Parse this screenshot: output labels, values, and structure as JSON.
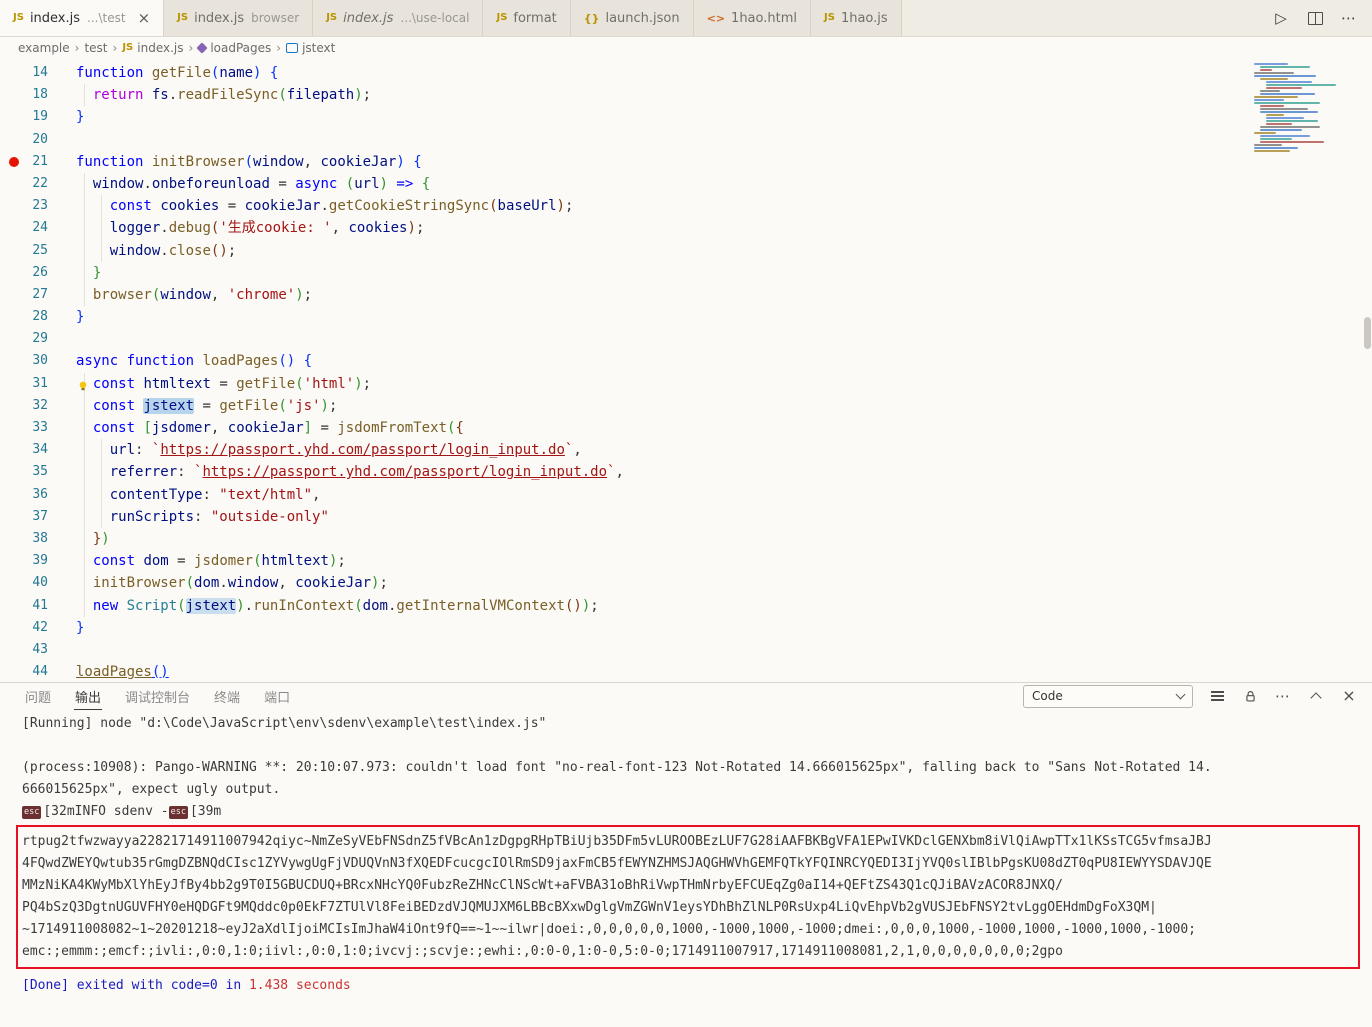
{
  "icons": {
    "run-icon": "▷",
    "more-icon": "⋯",
    "close-icon": "×",
    "js-file-icon": "JS",
    "json-file-icon": "{}",
    "html-file-icon": "<>"
  },
  "tab_bar": {
    "tabs": [
      {
        "label": "index.js",
        "hint": "...\\test",
        "icon": "js",
        "active": true,
        "closable": true
      },
      {
        "label": "index.js",
        "hint": "browser",
        "icon": "js"
      },
      {
        "label": "index.js",
        "hint": "...\\use-local",
        "icon": "js",
        "italic": true
      },
      {
        "label": "format",
        "hint": "",
        "icon": "js"
      },
      {
        "label": "launch.json",
        "hint": "",
        "icon": "braces"
      },
      {
        "label": "1hao.html",
        "hint": "",
        "icon": "html"
      },
      {
        "label": "1hao.js",
        "hint": "",
        "icon": "js"
      }
    ]
  },
  "breadcrumb": {
    "items": [
      {
        "label": "example"
      },
      {
        "label": "test"
      },
      {
        "label": "index.js",
        "icon": "js"
      },
      {
        "label": "loadPages",
        "icon": "method"
      },
      {
        "label": "jstext",
        "icon": "variable"
      }
    ]
  },
  "editor": {
    "lines": [
      {
        "n": 14,
        "ind": 0,
        "tokens": [
          [
            "function",
            "kw"
          ],
          [
            " ",
            "pl"
          ],
          [
            "getFile",
            "fn"
          ],
          [
            "(",
            "b1"
          ],
          [
            "name",
            "vr"
          ],
          [
            ")",
            "b1"
          ],
          [
            " ",
            "pl"
          ],
          [
            "{",
            "b1"
          ]
        ]
      },
      {
        "n": 18,
        "ind": 1,
        "tokens": [
          [
            "  ",
            "pl"
          ],
          [
            "return",
            "ctl"
          ],
          [
            " ",
            "pl"
          ],
          [
            "fs",
            "vr"
          ],
          [
            ".",
            "pl"
          ],
          [
            "readFileSync",
            "fn"
          ],
          [
            "(",
            "b2"
          ],
          [
            "filepath",
            "vr"
          ],
          [
            ")",
            "b2"
          ],
          [
            ";",
            "pl"
          ]
        ]
      },
      {
        "n": 19,
        "ind": 0,
        "tokens": [
          [
            "}",
            "b1"
          ]
        ]
      },
      {
        "n": 20,
        "ind": 0,
        "tokens": []
      },
      {
        "n": 21,
        "ind": 0,
        "bp": true,
        "tokens": [
          [
            "function",
            "kw"
          ],
          [
            " ",
            "pl"
          ],
          [
            "initBrowser",
            "fn"
          ],
          [
            "(",
            "b1"
          ],
          [
            "window",
            "vr"
          ],
          [
            ", ",
            "pl"
          ],
          [
            "cookieJar",
            "vr"
          ],
          [
            ")",
            "b1"
          ],
          [
            " ",
            "pl"
          ],
          [
            "{",
            "b1"
          ]
        ]
      },
      {
        "n": 22,
        "ind": 1,
        "tokens": [
          [
            "  ",
            "pl"
          ],
          [
            "window",
            "vr"
          ],
          [
            ".",
            "pl"
          ],
          [
            "onbeforeunload",
            "vr"
          ],
          [
            " = ",
            "pl"
          ],
          [
            "async",
            "kw"
          ],
          [
            " ",
            "pl"
          ],
          [
            "(",
            "b2"
          ],
          [
            "url",
            "vr"
          ],
          [
            ")",
            "b2"
          ],
          [
            " ",
            "pl"
          ],
          [
            "=>",
            "kw"
          ],
          [
            " ",
            "pl"
          ],
          [
            "{",
            "b2"
          ]
        ]
      },
      {
        "n": 23,
        "ind": 2,
        "tokens": [
          [
            "    ",
            "pl"
          ],
          [
            "const",
            "kw"
          ],
          [
            " ",
            "pl"
          ],
          [
            "cookies",
            "vr"
          ],
          [
            " = ",
            "pl"
          ],
          [
            "cookieJar",
            "vr"
          ],
          [
            ".",
            "pl"
          ],
          [
            "getCookieStringSync",
            "fn"
          ],
          [
            "(",
            "b3"
          ],
          [
            "baseUrl",
            "vr"
          ],
          [
            ")",
            "b3"
          ],
          [
            ";",
            "pl"
          ]
        ]
      },
      {
        "n": 24,
        "ind": 2,
        "tokens": [
          [
            "    ",
            "pl"
          ],
          [
            "logger",
            "vr"
          ],
          [
            ".",
            "pl"
          ],
          [
            "debug",
            "fn"
          ],
          [
            "(",
            "b3"
          ],
          [
            "'生成cookie: '",
            "str"
          ],
          [
            ", ",
            "pl"
          ],
          [
            "cookies",
            "vr"
          ],
          [
            ")",
            "b3"
          ],
          [
            ";",
            "pl"
          ]
        ]
      },
      {
        "n": 25,
        "ind": 2,
        "tokens": [
          [
            "    ",
            "pl"
          ],
          [
            "window",
            "vr"
          ],
          [
            ".",
            "pl"
          ],
          [
            "close",
            "fn"
          ],
          [
            "(",
            "b3"
          ],
          [
            ")",
            "b3"
          ],
          [
            ";",
            "pl"
          ]
        ]
      },
      {
        "n": 26,
        "ind": 1,
        "tokens": [
          [
            "  ",
            "pl"
          ],
          [
            "}",
            "b2"
          ]
        ]
      },
      {
        "n": 27,
        "ind": 1,
        "tokens": [
          [
            "  ",
            "pl"
          ],
          [
            "browser",
            "fn"
          ],
          [
            "(",
            "b2"
          ],
          [
            "window",
            "vr"
          ],
          [
            ", ",
            "pl"
          ],
          [
            "'chrome'",
            "str"
          ],
          [
            ")",
            "b2"
          ],
          [
            ";",
            "pl"
          ]
        ]
      },
      {
        "n": 28,
        "ind": 0,
        "tokens": [
          [
            "}",
            "b1"
          ]
        ]
      },
      {
        "n": 29,
        "ind": 0,
        "tokens": []
      },
      {
        "n": 30,
        "ind": 0,
        "tokens": [
          [
            "async",
            "kw"
          ],
          [
            " ",
            "pl"
          ],
          [
            "function",
            "kw"
          ],
          [
            " ",
            "pl"
          ],
          [
            "loadPages",
            "fn"
          ],
          [
            "(",
            "b1"
          ],
          [
            ")",
            "b1"
          ],
          [
            " ",
            "pl"
          ],
          [
            "{",
            "b1"
          ]
        ]
      },
      {
        "n": 31,
        "ind": 1,
        "bulb": true,
        "tokens": [
          [
            "  ",
            "pl"
          ],
          [
            "const",
            "kw"
          ],
          [
            " ",
            "pl"
          ],
          [
            "htmltext",
            "vr"
          ],
          [
            " = ",
            "pl"
          ],
          [
            "getFile",
            "fn"
          ],
          [
            "(",
            "b2"
          ],
          [
            "'html'",
            "str"
          ],
          [
            ")",
            "b2"
          ],
          [
            ";",
            "pl"
          ]
        ]
      },
      {
        "n": 32,
        "ind": 1,
        "tokens": [
          [
            "  ",
            "pl"
          ],
          [
            "const",
            "kw"
          ],
          [
            " ",
            "pl"
          ],
          [
            "jstext",
            "vr hl1"
          ],
          [
            " = ",
            "pl"
          ],
          [
            "getFile",
            "fn"
          ],
          [
            "(",
            "b2"
          ],
          [
            "'js'",
            "str"
          ],
          [
            ")",
            "b2"
          ],
          [
            ";",
            "pl"
          ]
        ]
      },
      {
        "n": 33,
        "ind": 1,
        "tokens": [
          [
            "  ",
            "pl"
          ],
          [
            "const",
            "kw"
          ],
          [
            " ",
            "pl"
          ],
          [
            "[",
            "b2"
          ],
          [
            "jsdomer",
            "vr"
          ],
          [
            ", ",
            "pl"
          ],
          [
            "cookieJar",
            "vr"
          ],
          [
            "]",
            "b2"
          ],
          [
            " = ",
            "pl"
          ],
          [
            "jsdomFromText",
            "fn"
          ],
          [
            "(",
            "b2"
          ],
          [
            "{",
            "b3"
          ]
        ]
      },
      {
        "n": 34,
        "ind": 2,
        "tokens": [
          [
            "    ",
            "pl"
          ],
          [
            "url",
            "vr"
          ],
          [
            ": ",
            "pl"
          ],
          [
            "`",
            "str"
          ],
          [
            "https://passport.yhd.com/passport/login_input.do",
            "lnk"
          ],
          [
            "`",
            "str"
          ],
          [
            ",",
            "pl"
          ]
        ]
      },
      {
        "n": 35,
        "ind": 2,
        "tokens": [
          [
            "    ",
            "pl"
          ],
          [
            "referrer",
            "vr"
          ],
          [
            ": ",
            "pl"
          ],
          [
            "`",
            "str"
          ],
          [
            "https://passport.yhd.com/passport/login_input.do",
            "lnk"
          ],
          [
            "`",
            "str"
          ],
          [
            ",",
            "pl"
          ]
        ]
      },
      {
        "n": 36,
        "ind": 2,
        "tokens": [
          [
            "    ",
            "pl"
          ],
          [
            "contentType",
            "vr"
          ],
          [
            ": ",
            "pl"
          ],
          [
            "\"text/html\"",
            "str"
          ],
          [
            ",",
            "pl"
          ]
        ]
      },
      {
        "n": 37,
        "ind": 2,
        "tokens": [
          [
            "    ",
            "pl"
          ],
          [
            "runScripts",
            "vr"
          ],
          [
            ": ",
            "pl"
          ],
          [
            "\"outside-only\"",
            "str"
          ]
        ]
      },
      {
        "n": 38,
        "ind": 1,
        "tokens": [
          [
            "  ",
            "pl"
          ],
          [
            "}",
            "b3"
          ],
          [
            ")",
            "b2"
          ]
        ]
      },
      {
        "n": 39,
        "ind": 1,
        "tokens": [
          [
            "  ",
            "pl"
          ],
          [
            "const",
            "kw"
          ],
          [
            " ",
            "pl"
          ],
          [
            "dom",
            "vr"
          ],
          [
            " = ",
            "pl"
          ],
          [
            "jsdomer",
            "fn"
          ],
          [
            "(",
            "b2"
          ],
          [
            "htmltext",
            "vr"
          ],
          [
            ")",
            "b2"
          ],
          [
            ";",
            "pl"
          ]
        ]
      },
      {
        "n": 40,
        "ind": 1,
        "tokens": [
          [
            "  ",
            "pl"
          ],
          [
            "initBrowser",
            "fn"
          ],
          [
            "(",
            "b2"
          ],
          [
            "dom",
            "vr"
          ],
          [
            ".",
            "pl"
          ],
          [
            "window",
            "vr"
          ],
          [
            ", ",
            "pl"
          ],
          [
            "cookieJar",
            "vr"
          ],
          [
            ")",
            "b2"
          ],
          [
            ";",
            "pl"
          ]
        ]
      },
      {
        "n": 41,
        "ind": 1,
        "tokens": [
          [
            "  ",
            "pl"
          ],
          [
            "new",
            "kw"
          ],
          [
            " ",
            "pl"
          ],
          [
            "Script",
            "cls"
          ],
          [
            "(",
            "b2"
          ],
          [
            "jstext",
            "vr hl2"
          ],
          [
            ")",
            "b2"
          ],
          [
            ".",
            "pl"
          ],
          [
            "runInContext",
            "fn"
          ],
          [
            "(",
            "b2"
          ],
          [
            "dom",
            "vr"
          ],
          [
            ".",
            "pl"
          ],
          [
            "getInternalVMContext",
            "fn"
          ],
          [
            "(",
            "b3"
          ],
          [
            ")",
            "b3"
          ],
          [
            ")",
            "b2"
          ],
          [
            ";",
            "pl"
          ]
        ]
      },
      {
        "n": 42,
        "ind": 0,
        "tokens": [
          [
            "}",
            "b1"
          ]
        ]
      },
      {
        "n": 43,
        "ind": 0,
        "tokens": []
      },
      {
        "n": 44,
        "ind": 0,
        "tokens": [
          [
            "loadPages",
            "fn und"
          ],
          [
            "(",
            "b1 und"
          ],
          [
            ")",
            "b1 und"
          ]
        ]
      }
    ]
  },
  "panel": {
    "tabs": [
      {
        "label": "问题"
      },
      {
        "label": "输出",
        "active": true
      },
      {
        "label": "调试控制台"
      },
      {
        "label": "终端"
      },
      {
        "label": "端口"
      }
    ],
    "channel_select": {
      "value": "Code"
    },
    "output": {
      "running_line": "[Running] node \"d:\\Code\\JavaScript\\env\\sdenv\\example\\test\\index.js\"",
      "warning_lines": [
        "(process:10908): Pango-WARNING **: 20:10:07.973: couldn't load font \"no-real-font-123 Not-Rotated 14.666015625px\", falling back to \"Sans Not-Rotated 14.",
        "666015625px\", expect ugly output."
      ],
      "ansi_line": {
        "esc_label": "esc",
        "part1": "[32mINFO sdenv -",
        "part2": "[39m"
      },
      "boxed_lines": [
        "rtpug2tfwzwayya22821714911007942qiyc~NmZeSyVEbFNSdnZ5fVBcAn1zDgpgRHpTBiUjb35DFm5vLUROOBEzLUF7G28iAAFBKBgVFA1EPwIVKDclGENXbm8iVlQiAwpTTx1lKSsTCG5vfmsaJBJ",
        "4FQwdZWEYQwtub35rGmgDZBNQdCIsc1ZYVywgUgFjVDUQVnN3fXQEDFcucgcIOlRmSD9jaxFmCB5fEWYNZHMSJAQGHWVhGEMFQTkYFQINRCYQEDI3IjYVQ0slIBlbPgsKU08dZT0qPU8IEWYYSDAVJQE",
        "MMzNiKA4KWyMbXlYhEyJfBy4bb2g9T0I5GBUCDUQ+BRcxNHcYQ0FubzReZHNcClNScWt+aFVBA31oBhRiVwpTHmNrbyEFCUEqZg0aI14+QEFtZS43Q1cQJiBAVzACOR8JNXQ/",
        "PQ4bSzQ3DgtnUGUVFHY0eHQDGFt9MQddc0p0EkF7ZTUlVl8FeiBEDzdVJQMUJXM6LBBcBXxwDglgVmZGWnV1eysYDhBhZlNLP0RsUxp4LiQvEhpVb2gVUSJEbFNSY2tvLggOEHdmDgFoX3QM|",
        "~1714911008082~1~20201218~eyJ2aXdlIjoiMCIsImJhaW4iOnt9fQ==~1~~ilwr|doei:,0,0,0,0,0,1000,-1000,1000,-1000;dmei:,0,0,0,1000,-1000,1000,-1000,1000,-1000;",
        "emc:;emmm:;emcf:;ivli:,0:0,1:0;iivl:,0:0,1:0;ivcvj:;scvje:;ewhi:,0:0-0,1:0-0,5:0-0;1714911007917,1714911008081,2,1,0,0,0,0,0,0,0;2gpo"
      ],
      "done_line": {
        "blue": "[Done] exited with code=0 in ",
        "red": "1.438 seconds"
      }
    }
  }
}
